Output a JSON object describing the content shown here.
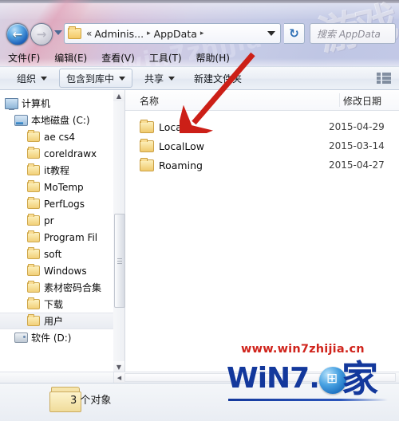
{
  "window": {
    "nav": {
      "back_icon": "back-arrow-icon",
      "back_glyph": "←",
      "forward_icon": "forward-arrow-icon",
      "forward_glyph": "→",
      "history_dropdown_icon": "chevron-down-icon"
    },
    "address_bar": {
      "folder_icon": "folder-icon",
      "overflow_chevron": "«",
      "crumb_user": "Adminis...",
      "crumb_current": "AppData",
      "separator": "▸",
      "dropdown_icon": "chevron-down-icon",
      "refresh_icon": "refresh-icon",
      "refresh_glyph": "↻"
    },
    "search": {
      "placeholder": "搜索 AppData",
      "icon": "search-icon"
    },
    "glass_watermark": {
      "big": "游戏",
      "small": "win7zhijia"
    }
  },
  "menubar": {
    "items": [
      {
        "label": "文件(F)",
        "name": "menu-file"
      },
      {
        "label": "编辑(E)",
        "name": "menu-edit"
      },
      {
        "label": "查看(V)",
        "name": "menu-view"
      },
      {
        "label": "工具(T)",
        "name": "menu-tools"
      },
      {
        "label": "帮助(H)",
        "name": "menu-help"
      }
    ]
  },
  "toolbar": {
    "organize": "组织",
    "include_in_library": "包含到库中",
    "share": "共享",
    "new_folder": "新建文件夹",
    "view_icon": "view-mode-icon"
  },
  "nav_pane": {
    "items": [
      {
        "label": "计算机",
        "icon": "computer-icon",
        "indent": 0,
        "selected": false
      },
      {
        "label": "本地磁盘 (C:)",
        "icon": "hard-drive-icon",
        "indent": 1,
        "selected": false
      },
      {
        "label": "ae cs4",
        "icon": "folder-icon",
        "indent": 2,
        "selected": false
      },
      {
        "label": "coreldrawx",
        "icon": "folder-icon",
        "indent": 2,
        "selected": false
      },
      {
        "label": "it教程",
        "icon": "folder-icon",
        "indent": 2,
        "selected": false
      },
      {
        "label": "MoTemp",
        "icon": "folder-icon",
        "indent": 2,
        "selected": false
      },
      {
        "label": "PerfLogs",
        "icon": "folder-icon",
        "indent": 2,
        "selected": false
      },
      {
        "label": "pr",
        "icon": "folder-icon",
        "indent": 2,
        "selected": false
      },
      {
        "label": "Program Fil",
        "icon": "folder-icon",
        "indent": 2,
        "selected": false
      },
      {
        "label": "soft",
        "icon": "folder-icon",
        "indent": 2,
        "selected": false
      },
      {
        "label": "Windows",
        "icon": "folder-icon",
        "indent": 2,
        "selected": false
      },
      {
        "label": "素材密码合集",
        "icon": "folder-icon",
        "indent": 2,
        "selected": false
      },
      {
        "label": "下载",
        "icon": "folder-icon",
        "indent": 2,
        "selected": false
      },
      {
        "label": "用户",
        "icon": "folder-icon",
        "indent": 2,
        "selected": true
      },
      {
        "label": "软件 (D:)",
        "icon": "drive-icon",
        "indent": 1,
        "selected": false
      }
    ],
    "scroll_up_glyph": "▲",
    "scroll_down_glyph": "▼"
  },
  "file_pane": {
    "columns": [
      "名称",
      "修改日期"
    ],
    "rows": [
      {
        "name": "Local",
        "date": "2015-04-29",
        "icon": "folder-icon"
      },
      {
        "name": "LocalLow",
        "date": "2015-03-14",
        "icon": "folder-icon"
      },
      {
        "name": "Roaming",
        "date": "2015-04-27",
        "icon": "folder-icon"
      }
    ]
  },
  "status_bar": {
    "text": "3 个对象",
    "folder_icon": "large-folder-icon"
  },
  "annotation": {
    "arrow_color": "#cc1f17",
    "points_to": "Local"
  },
  "watermark": {
    "url": "www.win7zhijia.cn",
    "logo_text": "WiN7.",
    "logo_cn": "家",
    "orb_glyph": "⊞",
    "url_color": "#d0241c",
    "logo_color": "#13389c"
  }
}
